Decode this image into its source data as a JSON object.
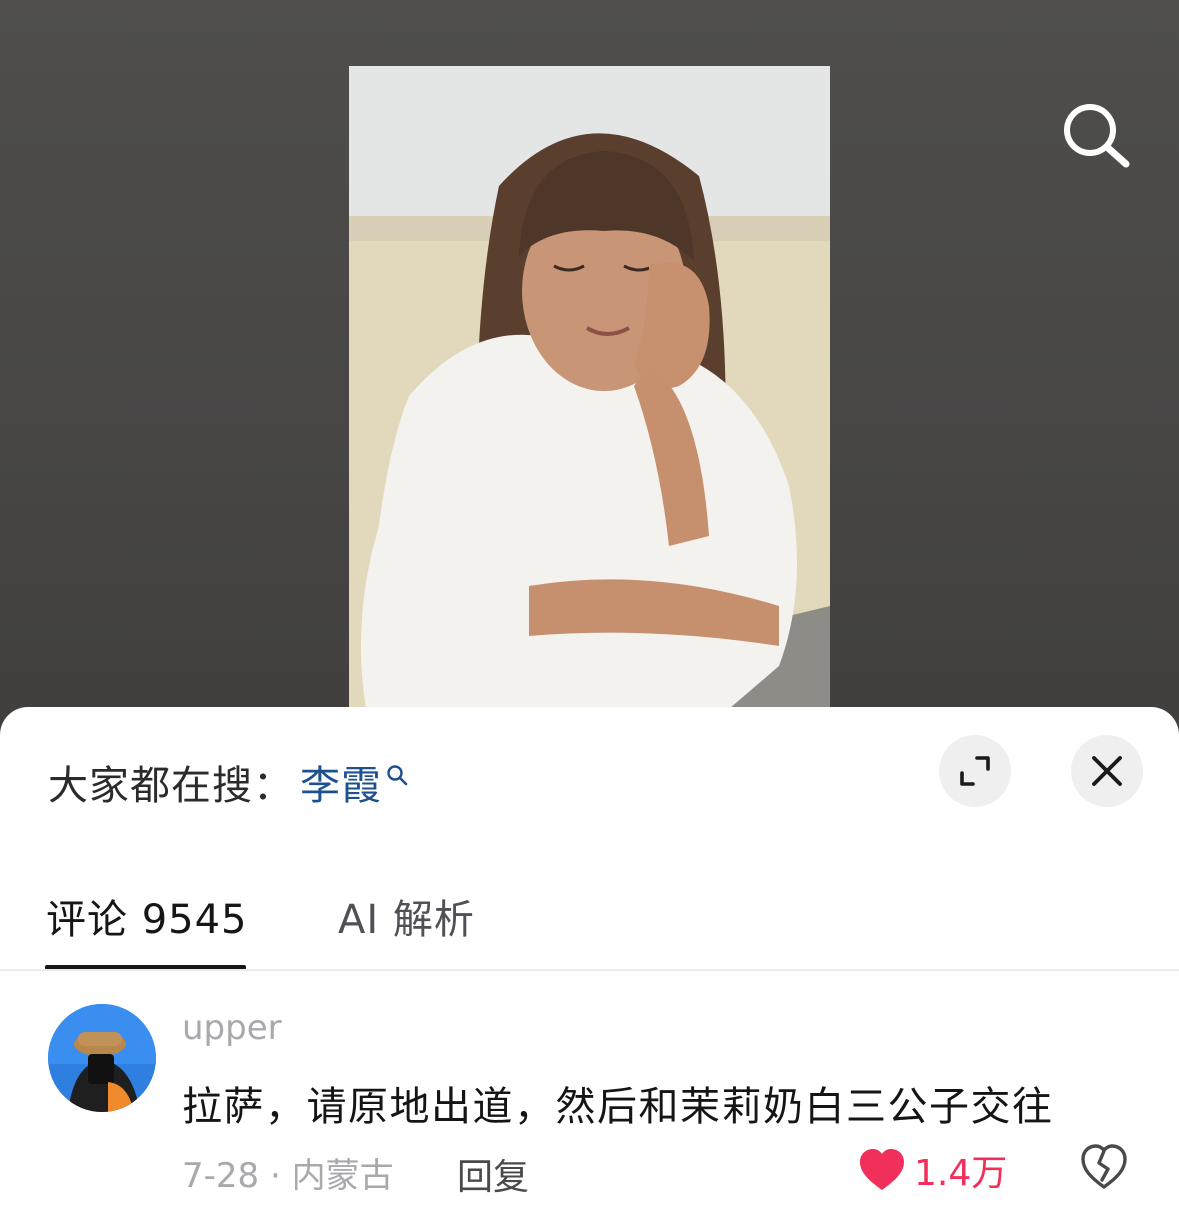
{
  "search_suggestion": {
    "prefix": "大家都在搜：",
    "keyword": "李霞"
  },
  "tabs": [
    {
      "label": "评论 9545",
      "active": true
    },
    {
      "label": "AI 解析",
      "active": false
    }
  ],
  "comment": {
    "username": "upper",
    "text": "拉萨，请原地出道，然后和茉莉奶白三公子交往",
    "date_location": "7-28 · 内蒙古",
    "reply_label": "回复",
    "like_count": "1.4万"
  },
  "icons": {
    "top_search": "search-icon",
    "expand": "expand-icon",
    "close": "close-icon",
    "like": "heart-icon",
    "dislike": "broken-heart-icon"
  },
  "colors": {
    "keyword": "#1e4f8f",
    "like": "#f0305a",
    "sheet": "#ffffff",
    "video_bg": "#4a4947"
  }
}
